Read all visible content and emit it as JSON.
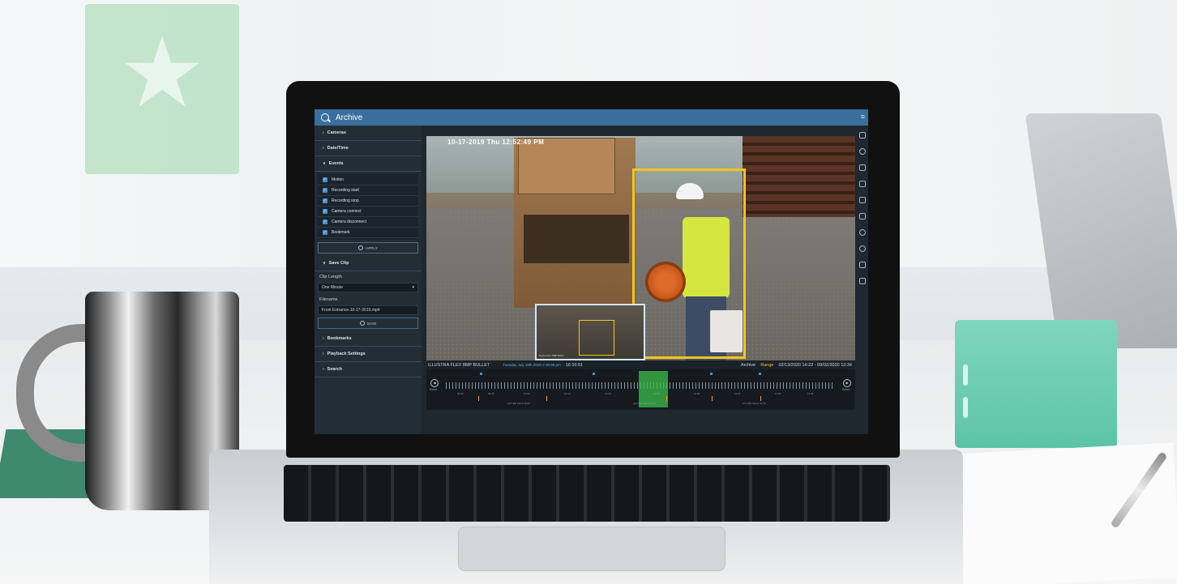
{
  "app": {
    "title": "Archive"
  },
  "sidebar": {
    "cameras": "Cameras",
    "datetime": "Date/Time",
    "events_header": "Events",
    "events": [
      {
        "label": "Motion",
        "checked": true
      },
      {
        "label": "Recording start",
        "checked": true
      },
      {
        "label": "Recording stop",
        "checked": true
      },
      {
        "label": "Camera connect",
        "checked": true
      },
      {
        "label": "Camera disconnect",
        "checked": true
      },
      {
        "label": "Bookmark",
        "checked": true
      }
    ],
    "apply_label": "APPLY",
    "save_clip": "Save Clip",
    "clip_length_label": "Clip Length",
    "clip_length_value": "One Minute",
    "filename_label": "Filename",
    "filename_value": "Front Entrance-10-17-2019.mp4",
    "save_label": "SAVE",
    "bookmarks": "Bookmarks",
    "playback_settings": "Playback Settings",
    "search": "Search"
  },
  "video": {
    "osd": "10-17-2019  Thu 12:52:49 PM",
    "pip_label": "Illustra Flex 8MP Bullet"
  },
  "infobar": {
    "camera": "ILLUSTRA FLEX 8MP BULLET",
    "date": "Tuesday July 28th 2020 2:38:58 pm",
    "time": "16:16:51",
    "mode": "Archive",
    "range_label": "Range",
    "range": "02/13/2020 14:22 - 08/02/2020 13:34"
  },
  "timeline": {
    "prev_label": "Event",
    "next_label": "Event",
    "tick_labels": [
      "09:30",
      "09:45",
      "10:00",
      "10:15",
      "10:30",
      "10:45",
      "11:00",
      "11:15",
      "11:30",
      "11:45"
    ],
    "event_labels": [
      "ACT-BD Sanitz Bustr",
      "ACT-BD Sanitz 10:54",
      "ACT-BD Sanitz 01:30"
    ]
  },
  "colors": {
    "topbar": "#3a6e9d",
    "bbox": "#f5c518",
    "selection": "#3bbf4a",
    "checkbox": "#4a8fd1"
  }
}
